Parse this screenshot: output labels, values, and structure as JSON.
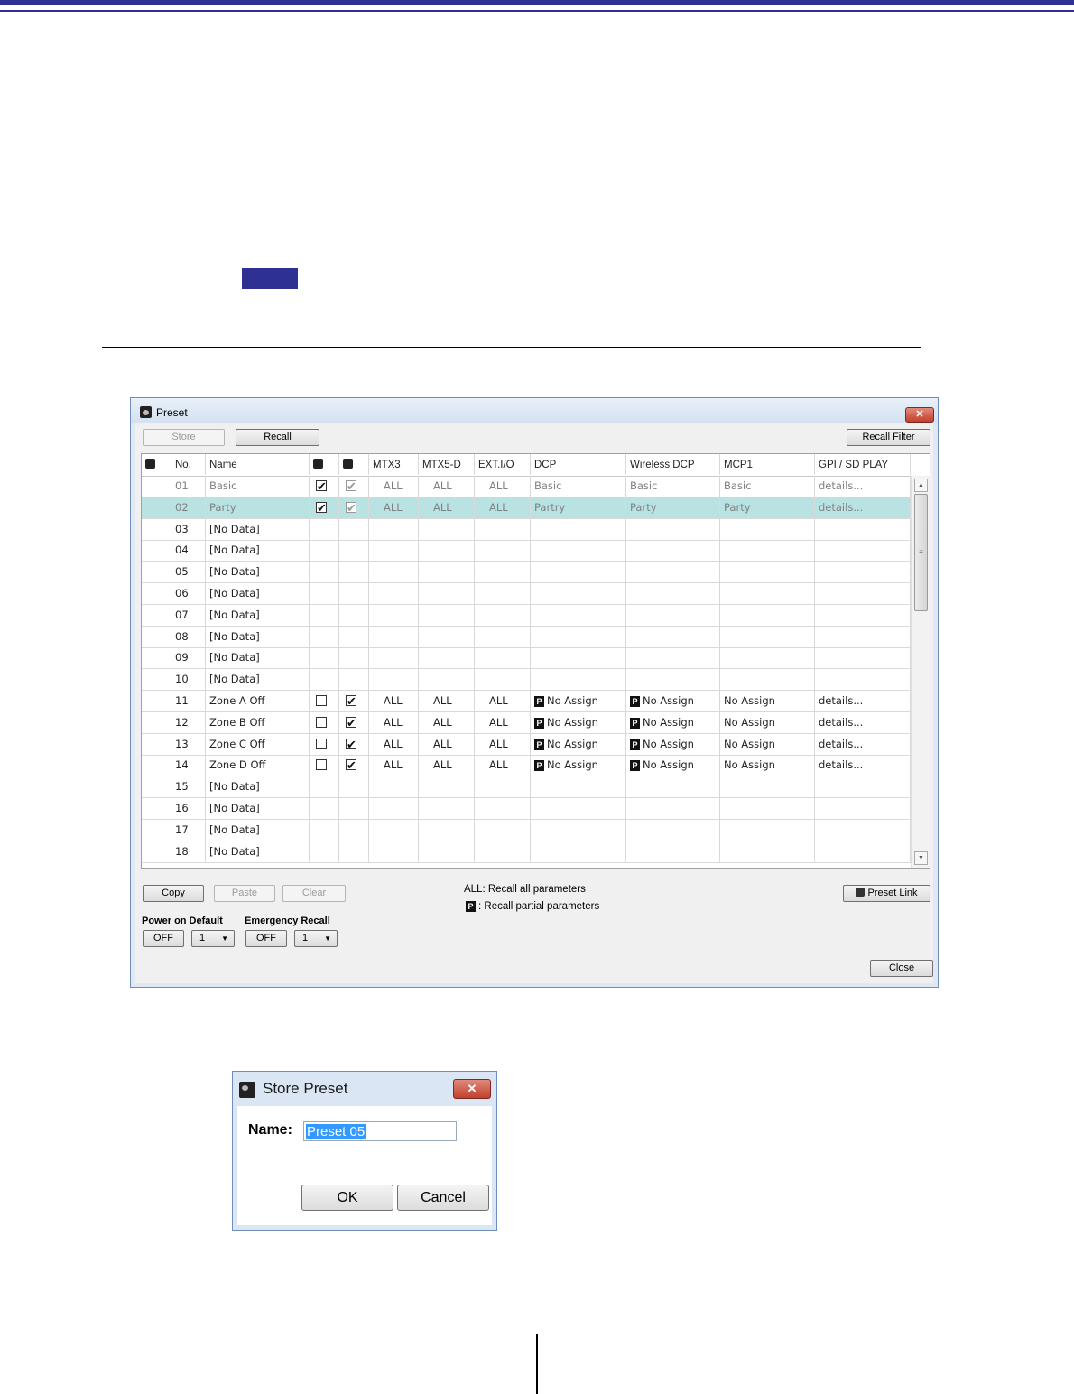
{
  "preset_window": {
    "title": "Preset",
    "close_glyph": "✕",
    "toolbar": {
      "store": "Store",
      "recall": "Recall",
      "recall_filter": "Recall Filter"
    },
    "columns": [
      "No.",
      "Name",
      "MTX3",
      "MTX5-D",
      "EXT.I/O",
      "DCP",
      "Wireless DCP",
      "MCP1",
      "GPI / SD PLAY"
    ],
    "header_icons": [
      "link-icon",
      "lock-icon",
      "clock-icon"
    ],
    "rows": [
      {
        "no": "01",
        "name": "Basic",
        "protect": true,
        "schedule": true,
        "mtx3": "ALL",
        "mtx5d": "ALL",
        "extio": "ALL",
        "dcp": "Basic",
        "dcp_partial": false,
        "wdcp": "Basic",
        "wdcp_partial": false,
        "mcp1": "Basic",
        "gpi": "details...",
        "dim": true
      },
      {
        "no": "02",
        "name": "Party",
        "protect": true,
        "schedule": true,
        "mtx3": "ALL",
        "mtx5d": "ALL",
        "extio": "ALL",
        "dcp": "Partry",
        "dcp_partial": false,
        "wdcp": "Party",
        "wdcp_partial": false,
        "mcp1": "Party",
        "gpi": "details...",
        "dim": true,
        "selected": true
      },
      {
        "no": "03",
        "name": "[No Data]"
      },
      {
        "no": "04",
        "name": "[No Data]"
      },
      {
        "no": "05",
        "name": "[No Data]"
      },
      {
        "no": "06",
        "name": "[No Data]"
      },
      {
        "no": "07",
        "name": "[No Data]"
      },
      {
        "no": "08",
        "name": "[No Data]"
      },
      {
        "no": "09",
        "name": "[No Data]"
      },
      {
        "no": "10",
        "name": "[No Data]"
      },
      {
        "no": "11",
        "name": "Zone A Off",
        "protect": false,
        "schedule": true,
        "mtx3": "ALL",
        "mtx5d": "ALL",
        "extio": "ALL",
        "dcp": "No Assign",
        "dcp_partial": true,
        "wdcp": "No Assign",
        "wdcp_partial": true,
        "mcp1": "No Assign",
        "gpi": "details..."
      },
      {
        "no": "12",
        "name": "Zone B Off",
        "protect": false,
        "schedule": true,
        "mtx3": "ALL",
        "mtx5d": "ALL",
        "extio": "ALL",
        "dcp": "No Assign",
        "dcp_partial": true,
        "wdcp": "No Assign",
        "wdcp_partial": true,
        "mcp1": "No Assign",
        "gpi": "details..."
      },
      {
        "no": "13",
        "name": "Zone C Off",
        "protect": false,
        "schedule": true,
        "mtx3": "ALL",
        "mtx5d": "ALL",
        "extio": "ALL",
        "dcp": "No Assign",
        "dcp_partial": true,
        "wdcp": "No Assign",
        "wdcp_partial": true,
        "mcp1": "No Assign",
        "gpi": "details..."
      },
      {
        "no": "14",
        "name": "Zone D Off",
        "protect": false,
        "schedule": true,
        "mtx3": "ALL",
        "mtx5d": "ALL",
        "extio": "ALL",
        "dcp": "No Assign",
        "dcp_partial": true,
        "wdcp": "No Assign",
        "wdcp_partial": true,
        "mcp1": "No Assign",
        "gpi": "details..."
      },
      {
        "no": "15",
        "name": "[No Data]"
      },
      {
        "no": "16",
        "name": "[No Data]"
      },
      {
        "no": "17",
        "name": "[No Data]"
      },
      {
        "no": "18",
        "name": "[No Data]"
      }
    ],
    "partial_badge": "P",
    "bottom": {
      "copy": "Copy",
      "paste": "Paste",
      "clear": "Clear",
      "legend_all": "ALL: Recall all parameters",
      "legend_partial": ": Recall partial parameters",
      "preset_link": "Preset Link",
      "power_on_default_label": "Power on Default",
      "power_on_default_state": "OFF",
      "power_on_default_value": "1",
      "emergency_recall_label": "Emergency Recall",
      "emergency_recall_state": "OFF",
      "emergency_recall_value": "1",
      "close": "Close"
    },
    "dropdown_arrow": "▼",
    "scroll_up": "▲",
    "scroll_down": "▼",
    "scroll_grip": "≡"
  },
  "store_dialog": {
    "title": "Store Preset",
    "close_glyph": "✕",
    "name_label": "Name:",
    "name_value": "Preset 05",
    "ok": "OK",
    "cancel": "Cancel"
  },
  "colors": {
    "accent": "#2e3192",
    "selected_row": "#b9e3e3",
    "window_frame": "#dfe9f5"
  }
}
